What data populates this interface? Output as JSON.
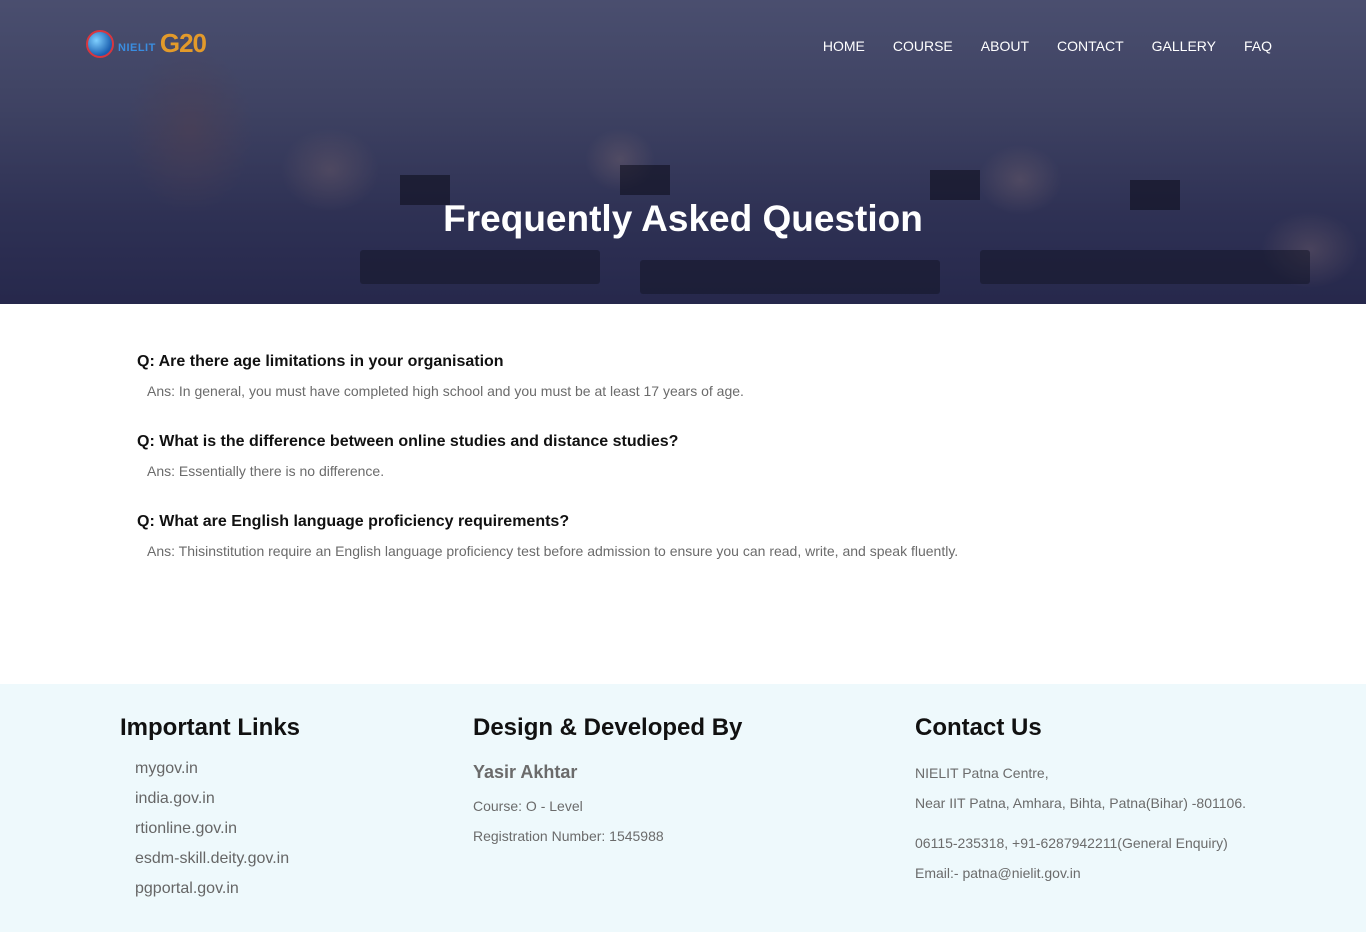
{
  "header": {
    "logo": {
      "brand_text": "NIELIT",
      "g20_text": "G20"
    },
    "nav": [
      "HOME",
      "COURSE",
      "ABOUT",
      "CONTACT",
      "GALLERY",
      "FAQ"
    ],
    "hero_title": "Frequently Asked Question"
  },
  "faq": [
    {
      "q": "Q: Are there age limitations in your organisation",
      "a": "Ans: In general, you must have completed high school and you must be at least 17 years of age."
    },
    {
      "q": "Q: What is the difference between online studies and distance studies?",
      "a": "Ans: Essentially there is no difference."
    },
    {
      "q": "Q: What are English language proficiency requirements?",
      "a": "Ans: Thisinstitution require an English language proficiency test before admission to ensure you can read, write, and speak fluently."
    }
  ],
  "footer": {
    "links_title": "Important Links",
    "links": [
      "mygov.in",
      "india.gov.in",
      "rtionline.gov.in",
      "esdm-skill.deity.gov.in",
      "pgportal.gov.in"
    ],
    "dev_title": "Design & Developed By",
    "dev_name": "Yasir Akhtar",
    "dev_course": "Course: O - Level",
    "dev_reg": "Registration Number: 1545988",
    "contact_title": "Contact Us",
    "contact_line1": "NIELIT Patna Centre,",
    "contact_line2": "Near IIT Patna, Amhara, Bihta, Patna(Bihar) -801106.",
    "contact_phone": "06115-235318, +91-6287942211(General Enquiry)",
    "contact_email": "Email:- patna@nielit.gov.in"
  },
  "colors": {
    "footer_bg": "#eef9fc",
    "hero_overlay": "#1e2046"
  }
}
